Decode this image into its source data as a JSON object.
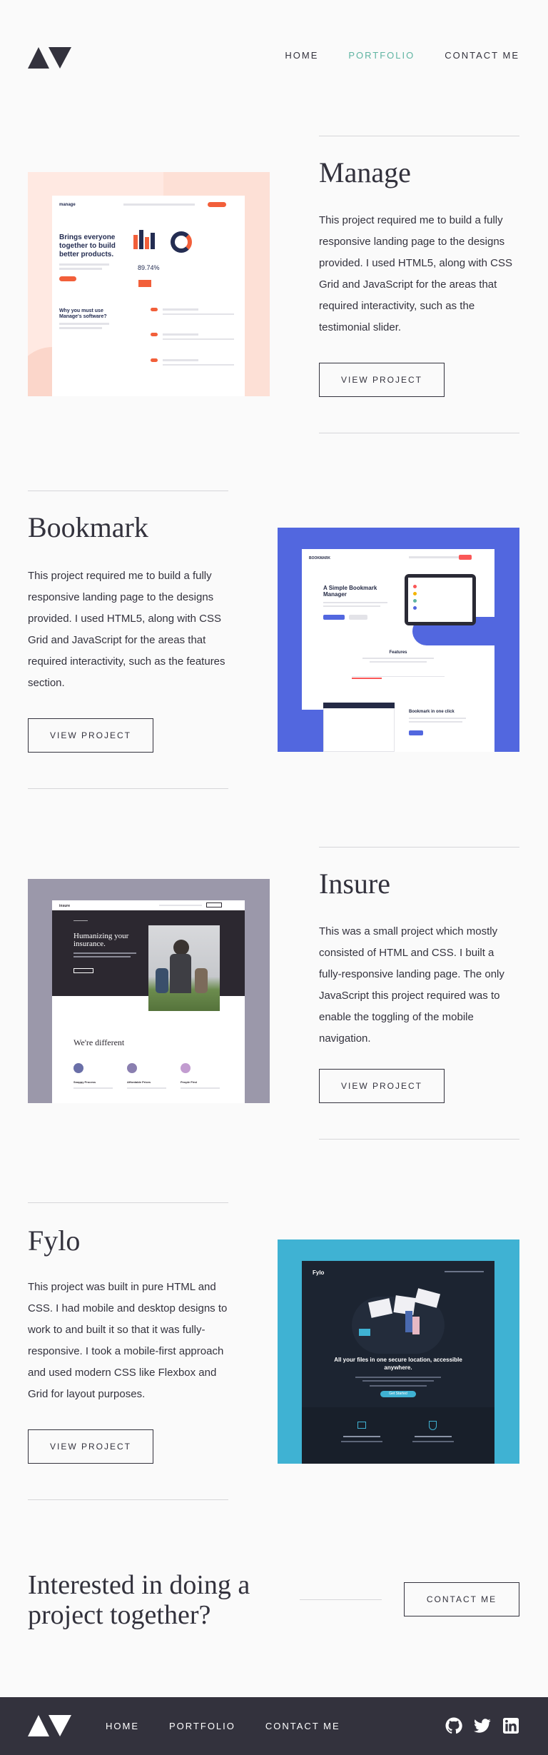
{
  "nav": {
    "home": "HOME",
    "portfolio": "PORTFOLIO",
    "contact": "CONTACT ME"
  },
  "projects": [
    {
      "title": "Manage",
      "description": "This project required me to build a fully responsive landing page to the designs provided. I used HTML5, along with CSS Grid and JavaScript for the areas that required interactivity, such as the testimonial slider.",
      "button": "VIEW PROJECT",
      "preview": {
        "logo": "manage",
        "headline": "Brings everyone together to build better products.",
        "subhead": "Why you must use Manage's software?",
        "stat": "89.74%",
        "bg": "#ffe9e2"
      }
    },
    {
      "title": "Bookmark",
      "description": "This project required me to build a fully responsive landing page to the designs provided. I used HTML5, along with CSS Grid and JavaScript for the areas that required interactivity, such as the features section.",
      "button": "VIEW PROJECT",
      "preview": {
        "logo": "BOOKMARK",
        "headline": "A Simple Bookmark Manager",
        "features": "Features",
        "section": "Bookmark in one click",
        "bg": "#5267df"
      }
    },
    {
      "title": "Insure",
      "description": "This was a small project which mostly consisted of HTML and CSS. I built a fully-responsive landing page. The only JavaScript this project required was to enable the toggling of the mobile navigation.",
      "button": "VIEW PROJECT",
      "preview": {
        "logo": "insure",
        "headline": "Humanizing your insurance.",
        "subhead": "We're different",
        "cta": "VIEW PLANS",
        "items": [
          "Snappy Process",
          "Affordable Prices",
          "People First"
        ],
        "bg": "#9b98aa"
      }
    },
    {
      "title": "Fylo",
      "description": "This project was built in pure HTML and CSS. I had mobile and desktop designs to work to and built it so that it was fully-responsive. I took a mobile-first approach and used modern CSS like Flexbox and Grid for layout purposes.",
      "button": "VIEW PROJECT",
      "preview": {
        "logo": "Fylo",
        "headline": "All your files in one secure location, accessible anywhere.",
        "cta": "Get Started",
        "bg": "#3fb2d3"
      }
    }
  ],
  "contact": {
    "heading": "Interested in doing a project together?",
    "button": "CONTACT ME"
  },
  "icons": [
    "github-icon",
    "twitter-icon",
    "linkedin-icon"
  ],
  "colors": {
    "accent": "#5fb4a2",
    "dark": "#33323d",
    "background": "#fafafa"
  }
}
